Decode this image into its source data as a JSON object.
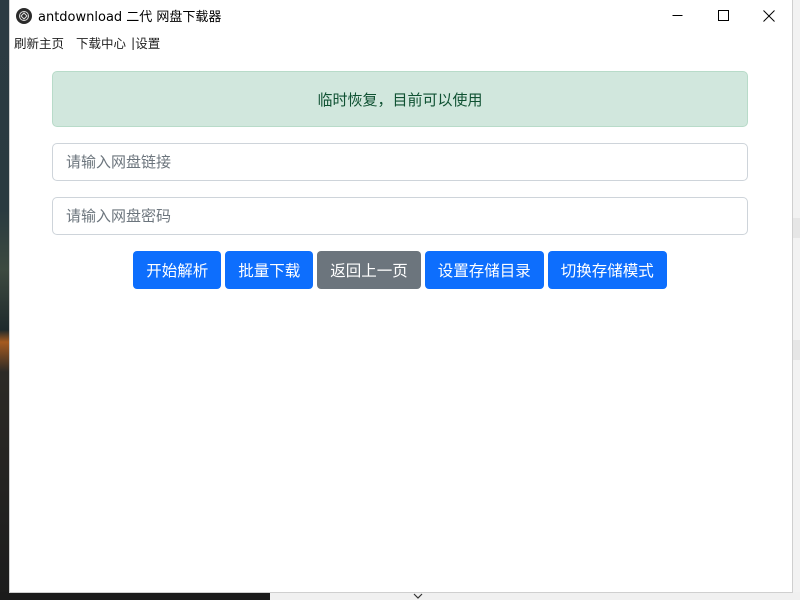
{
  "window": {
    "title": "antdownload 二代 网盘下载器"
  },
  "menu": {
    "refresh_home": "刷新主页",
    "download_center": "下载中心",
    "separator": "|",
    "settings": "设置"
  },
  "alert": {
    "text": "临时恢复，目前可以使用",
    "color": "#d1e7dd"
  },
  "inputs": {
    "link_placeholder": "请输入网盘链接",
    "link_value": "",
    "password_placeholder": "请输入网盘密码",
    "password_value": ""
  },
  "buttons": {
    "parse": "开始解析",
    "batch_download": "批量下载",
    "go_back": "返回上一页",
    "set_storage_dir": "设置存储目录",
    "switch_storage_mode": "切换存储模式"
  },
  "colors": {
    "primary": "#0d6efd",
    "secondary": "#6c757d",
    "alert_text": "#0f5132"
  },
  "icons": {
    "app": "app-logo-icon",
    "minimize": "minimize-icon",
    "maximize": "maximize-icon",
    "close": "close-icon"
  }
}
